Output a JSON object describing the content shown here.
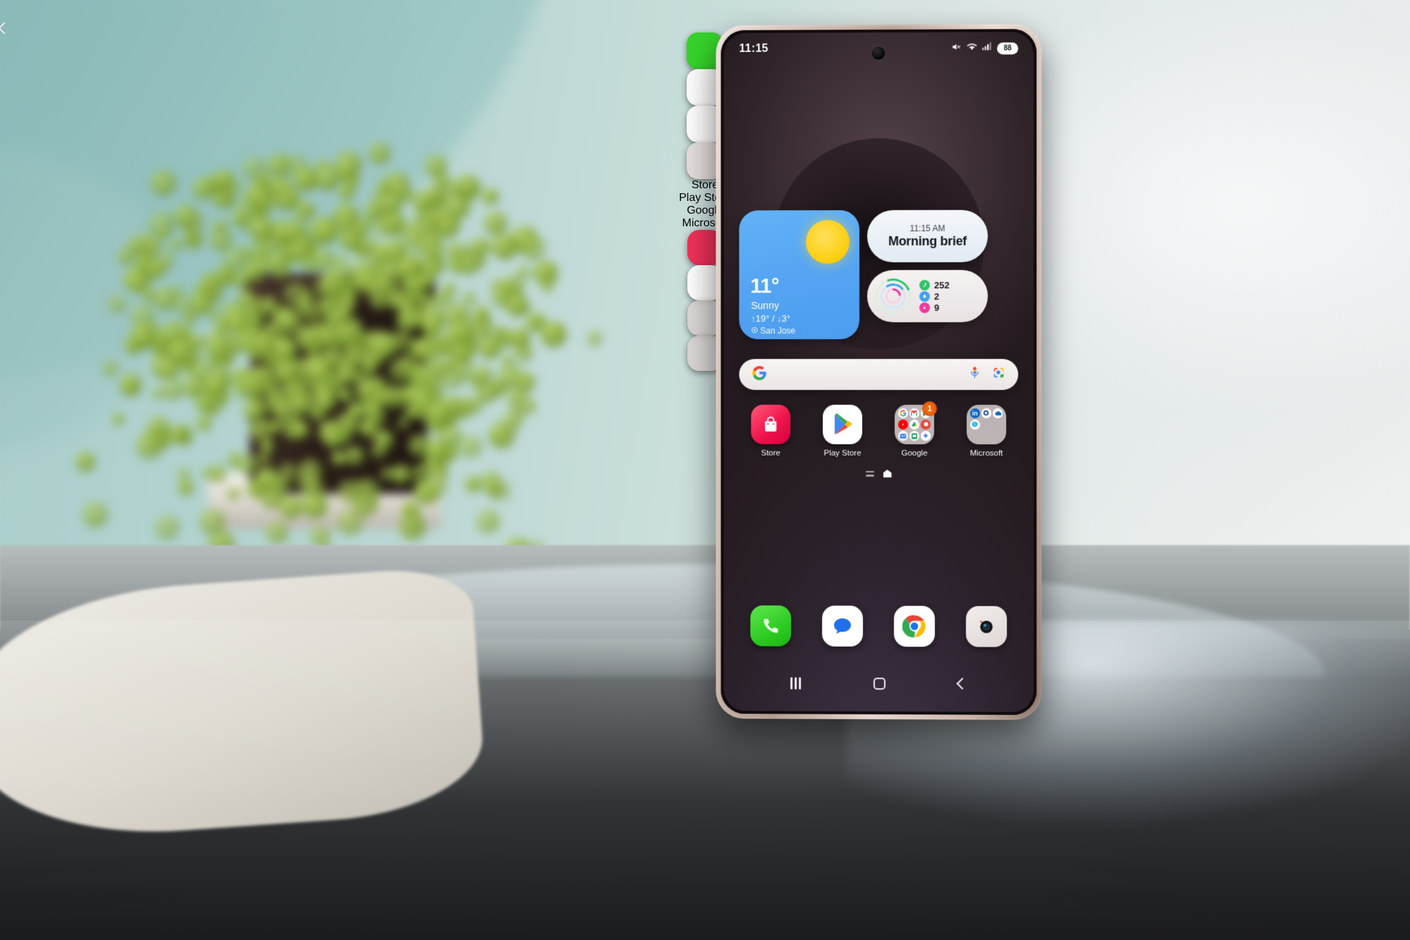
{
  "scene": {
    "description": "Samsung Galaxy smartphone standing on a glass table with reflection",
    "background_wall_color": "#b6d4d1",
    "table_color": "#9aa0a1",
    "plant": "trailing-green-plant-in-dark-pot",
    "stylus": "s-pen-stylus",
    "stylus_color": "#e6e0ee"
  },
  "phone": {
    "frame_color": "#d7c4bb",
    "statusbar": {
      "clock": "11:15",
      "icons": [
        {
          "name": "mute-icon",
          "glyph": "✕"
        },
        {
          "name": "wifi-icon",
          "glyph": "wifi"
        },
        {
          "name": "signal-icon",
          "glyph": "signal"
        }
      ],
      "battery_level": "88"
    },
    "widgets": {
      "weather": {
        "temperature": "11°",
        "condition": "Sunny",
        "high_low": "↑19° / ↓3°",
        "location": "San Jose",
        "bg_color": "#56a6f3",
        "sun_color": "#fdd013"
      },
      "brief": {
        "time": "11:15 AM",
        "title": "Morning brief"
      },
      "health": {
        "stats": [
          {
            "name": "steps",
            "value": "252",
            "color": "#2fc46a",
            "glyph": "👟"
          },
          {
            "name": "water",
            "value": "2",
            "color": "#3ea2f0",
            "glyph": "💧"
          },
          {
            "name": "activity",
            "value": "9",
            "color": "#f0399a",
            "glyph": "🔥"
          }
        ]
      }
    },
    "search": {
      "placeholder": "",
      "value": "",
      "google_logo": "google-g-icon",
      "actions": [
        {
          "name": "microphone-icon"
        },
        {
          "name": "google-lens-icon"
        }
      ]
    },
    "app_row": [
      {
        "name": "galaxy-store",
        "label": "Store",
        "type": "app",
        "color": "#f0305a"
      },
      {
        "name": "play-store",
        "label": "Play Store",
        "type": "app",
        "color": "#ffffff"
      },
      {
        "name": "google-folder",
        "label": "Google",
        "type": "folder",
        "badge": "1",
        "apps": [
          "Search",
          "Gmail",
          "Maps",
          "YouTube",
          "Drive",
          "Photos",
          "Messages",
          "Slides",
          "Gemini"
        ]
      },
      {
        "name": "microsoft-folder",
        "label": "Microsoft",
        "type": "folder",
        "badge": "",
        "apps": [
          "LinkedIn",
          "Office",
          "OneDrive",
          "Skype"
        ]
      }
    ],
    "page_indicator": {
      "items": [
        {
          "name": "app-list-page",
          "active": false
        },
        {
          "name": "home-page",
          "active": true
        }
      ]
    },
    "dock": [
      {
        "name": "phone-app",
        "label": "Phone",
        "color": "#35d42a"
      },
      {
        "name": "messages-app",
        "label": "Messages",
        "color": "#ffffff"
      },
      {
        "name": "chrome-app",
        "label": "Chrome",
        "color": "#ffffff"
      },
      {
        "name": "camera-app",
        "label": "Camera",
        "color": "#e4dedd"
      }
    ],
    "navbar": [
      {
        "name": "recents-button",
        "label": "Recents"
      },
      {
        "name": "home-button",
        "label": "Home"
      },
      {
        "name": "back-button",
        "label": "Back"
      }
    ],
    "side_buttons": [
      {
        "name": "volume-button"
      },
      {
        "name": "power-button"
      }
    ]
  }
}
